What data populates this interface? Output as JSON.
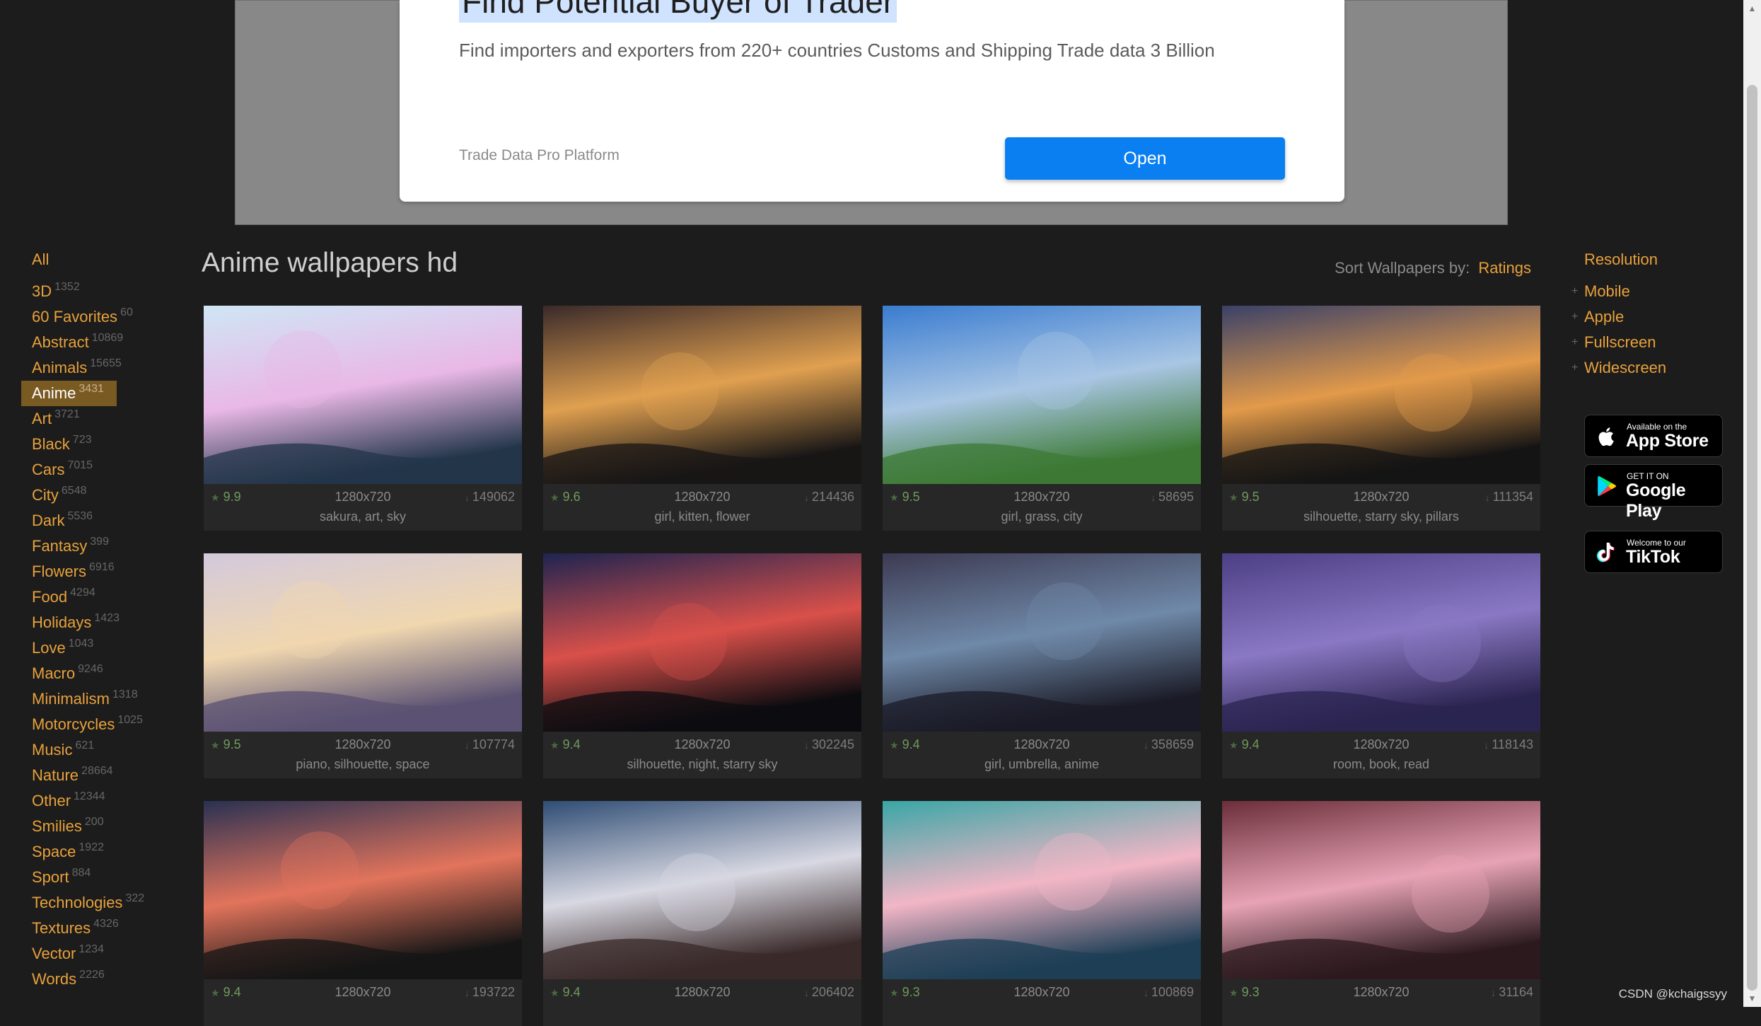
{
  "ad": {
    "headline": "Find Potential Buyer of Trader",
    "description": "Find importers and exporters from 220+ countries Customs and Shipping Trade data 3 Billion",
    "sponsor": "Trade Data Pro Platform",
    "open_label": "Open"
  },
  "page": {
    "title": "Anime wallpapers hd"
  },
  "sort": {
    "label": "Sort Wallpapers by:",
    "value": "Ratings"
  },
  "categories": {
    "all_label": "All",
    "items": [
      {
        "label": "3D",
        "count": "1352"
      },
      {
        "label": "60 Favorites",
        "count": "60"
      },
      {
        "label": "Abstract",
        "count": "10869"
      },
      {
        "label": "Animals",
        "count": "15655"
      },
      {
        "label": "Anime",
        "count": "3431",
        "active": true
      },
      {
        "label": "Art",
        "count": "3721"
      },
      {
        "label": "Black",
        "count": "723"
      },
      {
        "label": "Cars",
        "count": "7015"
      },
      {
        "label": "City",
        "count": "6548"
      },
      {
        "label": "Dark",
        "count": "5536"
      },
      {
        "label": "Fantasy",
        "count": "399"
      },
      {
        "label": "Flowers",
        "count": "6916"
      },
      {
        "label": "Food",
        "count": "4294"
      },
      {
        "label": "Holidays",
        "count": "1423"
      },
      {
        "label": "Love",
        "count": "1043"
      },
      {
        "label": "Macro",
        "count": "9246"
      },
      {
        "label": "Minimalism",
        "count": "1318"
      },
      {
        "label": "Motorcycles",
        "count": "1025"
      },
      {
        "label": "Music",
        "count": "621"
      },
      {
        "label": "Nature",
        "count": "28664"
      },
      {
        "label": "Other",
        "count": "12344"
      },
      {
        "label": "Smilies",
        "count": "200"
      },
      {
        "label": "Space",
        "count": "1922"
      },
      {
        "label": "Sport",
        "count": "884"
      },
      {
        "label": "Technologies",
        "count": "322"
      },
      {
        "label": "Textures",
        "count": "4326"
      },
      {
        "label": "Vector",
        "count": "1234"
      },
      {
        "label": "Words",
        "count": "2226"
      }
    ]
  },
  "wallpapers": [
    {
      "rating": "9.9",
      "resolution": "1280x720",
      "downloads": "149062",
      "tags": "sakura, art, sky",
      "colors": [
        "#cfe6f5",
        "#e9b8e6",
        "#23364a"
      ]
    },
    {
      "rating": "9.6",
      "resolution": "1280x720",
      "downloads": "214436",
      "tags": "girl, kitten, flower",
      "colors": [
        "#3a2a2a",
        "#e0a050",
        "#181616"
      ]
    },
    {
      "rating": "9.5",
      "resolution": "1280x720",
      "downloads": "58695",
      "tags": "girl, grass, city",
      "colors": [
        "#3a7cd0",
        "#a9c6e4",
        "#3d7a35"
      ]
    },
    {
      "rating": "9.5",
      "resolution": "1280x720",
      "downloads": "111354",
      "tags": "silhouette, starry sky, pillars",
      "colors": [
        "#3a4168",
        "#e29a4a",
        "#141414"
      ]
    },
    {
      "rating": "9.5",
      "resolution": "1280x720",
      "downloads": "107774",
      "tags": "piano, silhouette, space",
      "colors": [
        "#d3c9dc",
        "#f0d7b0",
        "#5b5273"
      ]
    },
    {
      "rating": "9.4",
      "resolution": "1280x720",
      "downloads": "302245",
      "tags": "silhouette, night, starry sky",
      "colors": [
        "#1e2450",
        "#d9504a",
        "#0c0c10"
      ]
    },
    {
      "rating": "9.4",
      "resolution": "1280x720",
      "downloads": "358659",
      "tags": "girl, umbrella, anime",
      "colors": [
        "#3d3a52",
        "#6f89a8",
        "#1b1b27"
      ]
    },
    {
      "rating": "9.4",
      "resolution": "1280x720",
      "downloads": "118143",
      "tags": "room, book, read",
      "colors": [
        "#4c3f85",
        "#8a78c4",
        "#2b2450"
      ]
    },
    {
      "rating": "9.4",
      "resolution": "1280x720",
      "downloads": "193722",
      "tags": "",
      "colors": [
        "#2a3152",
        "#e2745c",
        "#161616"
      ]
    },
    {
      "rating": "9.4",
      "resolution": "1280x720",
      "downloads": "206402",
      "tags": "",
      "colors": [
        "#2f4d74",
        "#d8d8e2",
        "#3a2a2a"
      ]
    },
    {
      "rating": "9.3",
      "resolution": "1280x720",
      "downloads": "100869",
      "tags": "",
      "colors": [
        "#3aa6a6",
        "#f2b6c6",
        "#1e3f56"
      ]
    },
    {
      "rating": "9.3",
      "resolution": "1280x720",
      "downloads": "31164",
      "tags": "",
      "colors": [
        "#6b2e3a",
        "#e7a3b5",
        "#2c1a1f"
      ]
    }
  ],
  "resolution": {
    "heading": "Resolution",
    "items": [
      "Mobile",
      "Apple",
      "Fullscreen",
      "Widescreen"
    ]
  },
  "badges": {
    "appstore": {
      "small": "Available on the",
      "big": "App Store",
      "icon": "apple-icon"
    },
    "googleplay": {
      "small": "GET IT ON",
      "big": "Google Play",
      "icon": "google-play-icon"
    },
    "tiktok": {
      "small": "Welcome to our",
      "big": "TikTok",
      "icon": "tiktok-icon"
    }
  },
  "watermark": "CSDN @kchaigssyy",
  "colors": {
    "accent": "#e8a13b",
    "active_bg": "#7a5a23",
    "page_bg": "#1c1c1c",
    "card_bg": "#272727",
    "ad_button": "#0a7ff2"
  }
}
